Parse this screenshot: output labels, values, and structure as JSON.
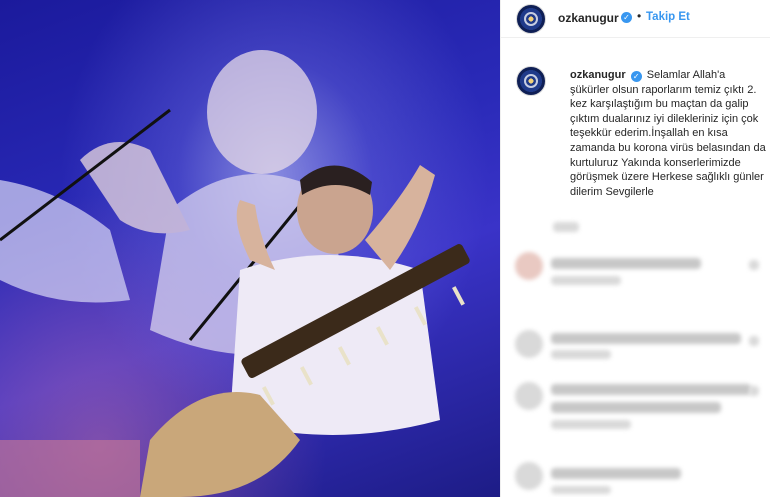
{
  "post": {
    "username": "ozkanugur",
    "verified_icon": "verified-check-icon",
    "follow_label": "Takip Et",
    "separator": "•",
    "caption": "Selamlar Allah'a şükürler olsun raporlarım temiz çıktı 2. kez karşılaştığım bu maçtan da galip çıktım dualarınız iyi dilekleriniz için çok teşekkür ederim.İnşallah en kısa zamanda bu korona virüs belasından da kurtuluruz Yakında konserlerimizde görüşmek üzere Herkese sağlıklı günler dilerim Sevgilerle"
  },
  "colors": {
    "accent": "#3897f0",
    "text": "#262626",
    "photo_bg": "#2a2ab8"
  }
}
